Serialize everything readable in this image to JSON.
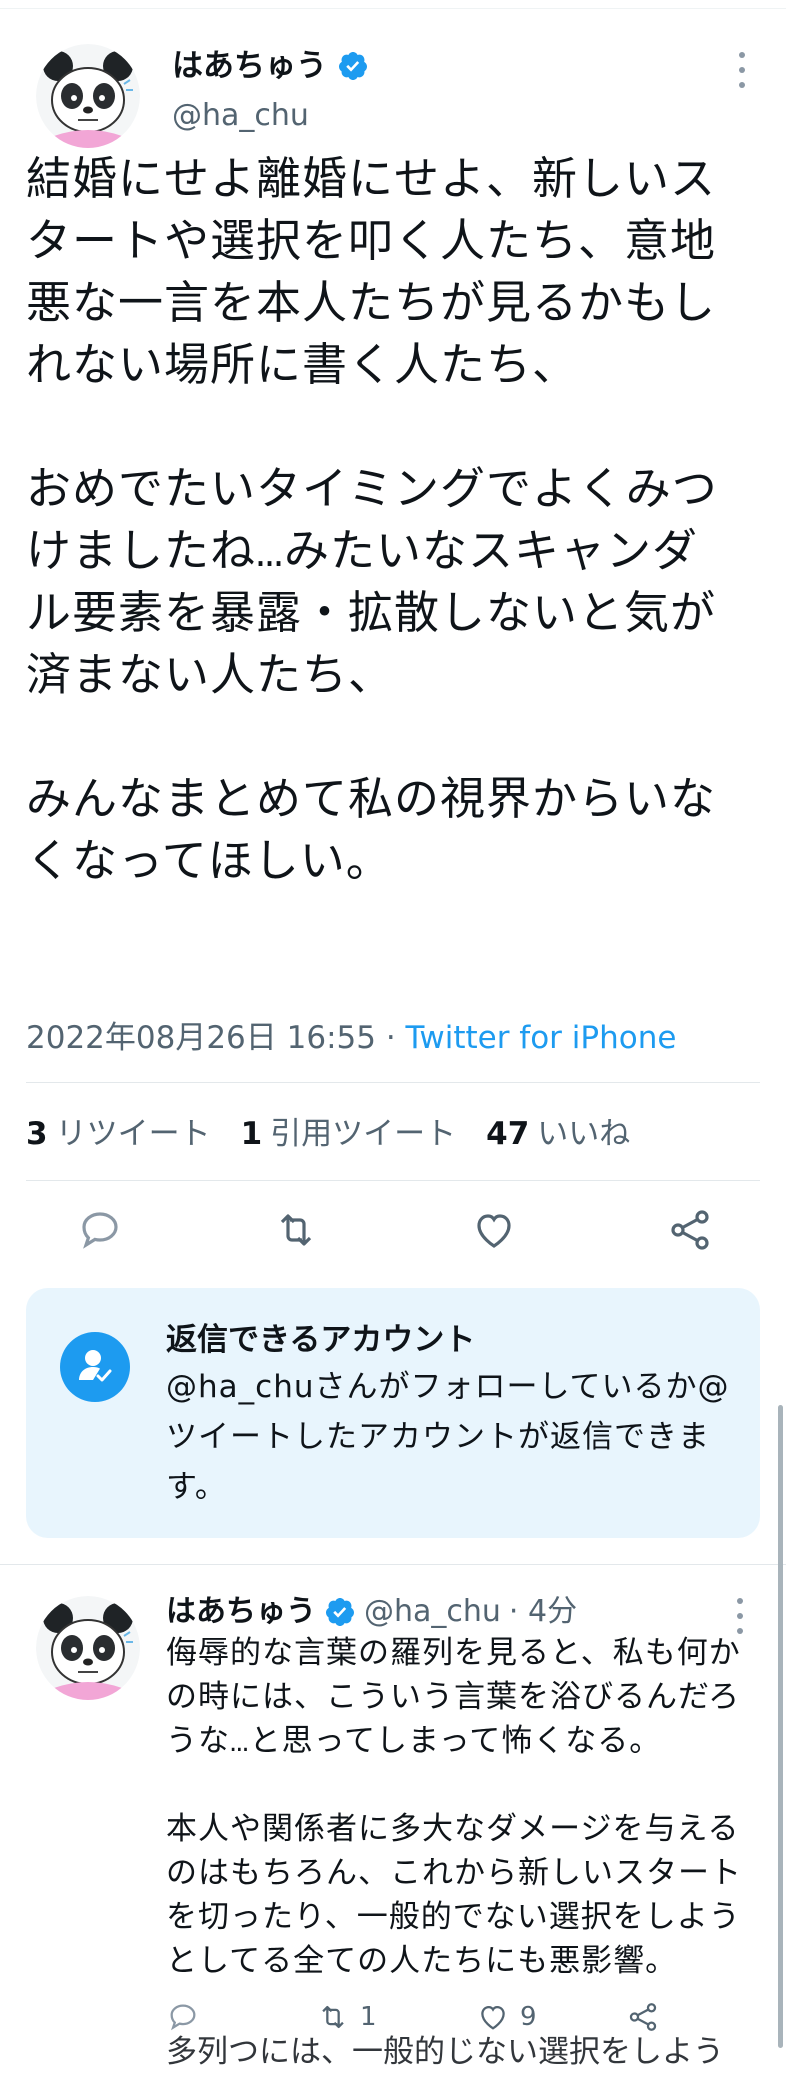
{
  "main_tweet": {
    "display_name": "はあちゅう",
    "handle": "@ha_chu",
    "avatar_icon": "panda-avatar",
    "verified_icon": "verified-badge-icon",
    "text": "結婚にせよ離婚にせよ、新しいス\nタートや選択を叩く人たち、意地\n悪な一言を本人たちが見るかもし\nれない場所に書く人たち、\n\nおめでたいタイミングでよくみつ\nけましたね…みたいなスキャンダ\nル要素を暴露・拡散しないと気が\n済まない人たち、\n\nみんなまとめて私の視界からいな\nくなってほしい。",
    "timestamp": "2022年08月26日 16:55",
    "separator": " · ",
    "via": "Twitter for iPhone"
  },
  "stats": [
    {
      "count": "3",
      "label": "リツイート"
    },
    {
      "count": "1",
      "label": "引用ツイート"
    },
    {
      "count": "47",
      "label": "いいね"
    }
  ],
  "actions": [
    "reply-icon",
    "retweet-icon",
    "like-icon",
    "share-icon"
  ],
  "reply_restriction": {
    "title": "返信できるアカウント",
    "text": "@ha_chuさんがフォローしているか@ツイートしたアカウントが返信できます。",
    "icon": "person-check-icon"
  },
  "reply": {
    "display_name": "はあちゅう",
    "handle": "@ha_chu",
    "time": "· 4分",
    "text": "侮辱的な言葉の羅列を見ると、私も何か\nの時には、こういう言葉を浴びるんだろ\nうな…と思ってしまって怖くなる。\n\n本人や関係者に多大なダメージを与える\nのはもちろん、これから新しいスタート\nを切ったり、一般的でない選択をしよう\nとしてる全ての人たちにも悪影響。",
    "retweet_count": "1",
    "like_count": "9",
    "cut_text": "多列つには、一般的じない選択をしよう"
  },
  "colors": {
    "accent": "#1d9bf0",
    "secondary_text": "#536471",
    "card_bg": "#e8f5fd"
  }
}
